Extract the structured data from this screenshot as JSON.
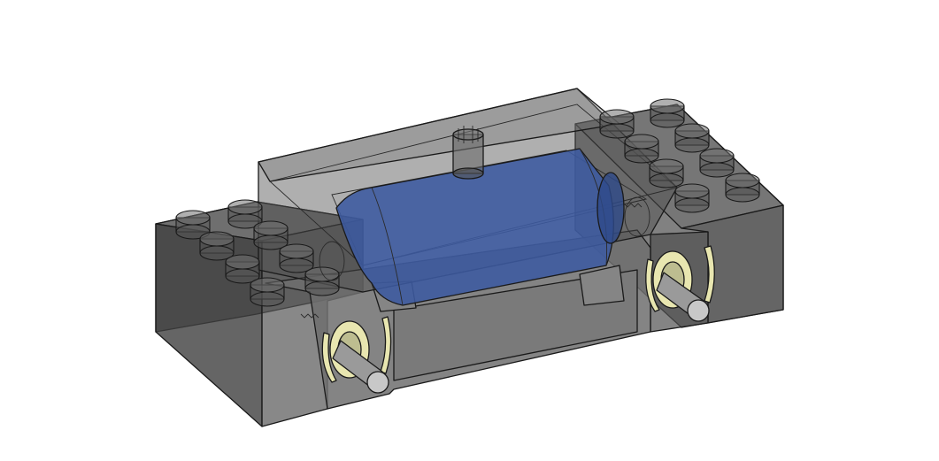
{
  "scene": {
    "subject": "",
    "background_color": "#ffffff",
    "colors": {
      "housing": "#5a5a5a",
      "motor": "#3c5aa0",
      "axle": "#9a9a9a",
      "gear_ring": "#e8e6b0"
    },
    "studs_per_side": 8
  }
}
